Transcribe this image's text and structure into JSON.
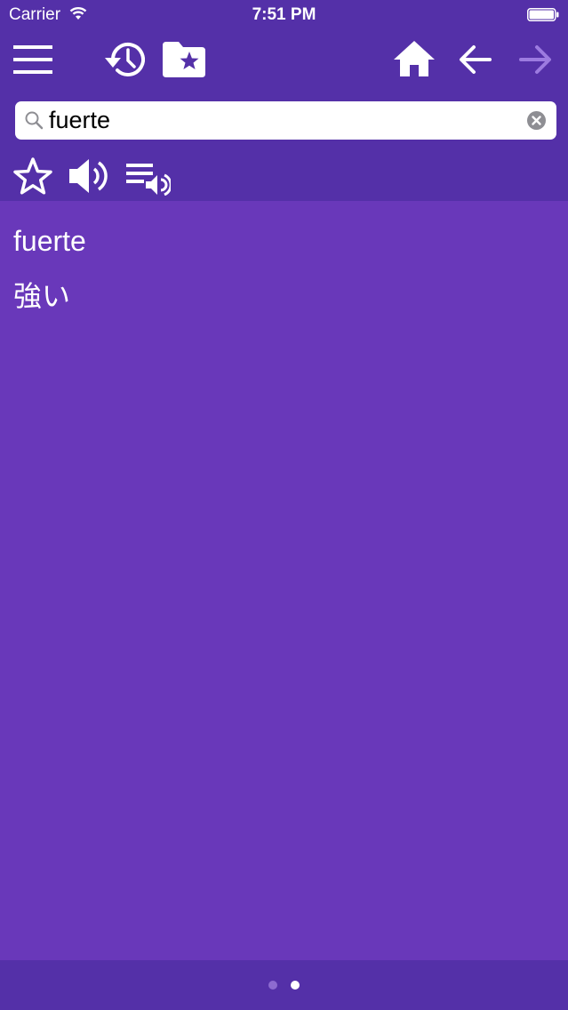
{
  "status_bar": {
    "carrier": "Carrier",
    "time": "7:51 PM"
  },
  "toolbar": {
    "icons": [
      "menu-icon",
      "history-icon",
      "favorites-folder-icon",
      "home-icon",
      "back-arrow-icon",
      "forward-arrow-icon"
    ],
    "forward_disabled": true
  },
  "search": {
    "value": "fuerte",
    "placeholder": ""
  },
  "actions": {
    "icons": [
      "star-icon",
      "speaker-icon",
      "playlist-speaker-icon"
    ]
  },
  "entry": {
    "headword": "fuerte",
    "translation": "強い"
  },
  "pager": {
    "page_count": 2,
    "current_page": 2
  },
  "colors": {
    "header_bg": "#5430A8",
    "content_bg": "#6938BA",
    "icon_color": "#FFFFFF",
    "disabled_icon": "#9C7BE0"
  }
}
